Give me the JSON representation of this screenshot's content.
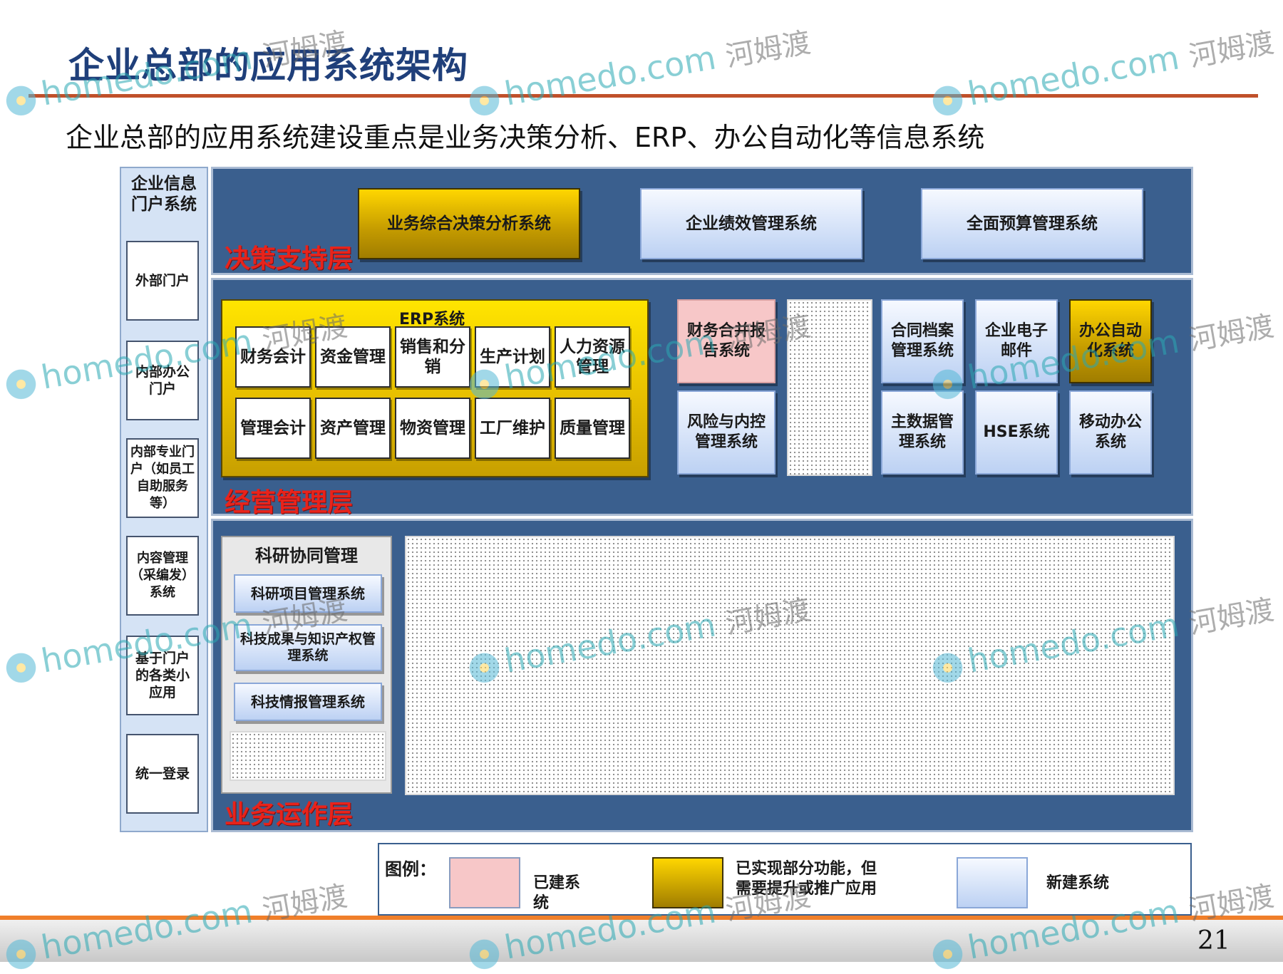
{
  "title": "企业总部的应用系统架构",
  "subtitle": "企业总部的应用系统建设重点是业务决策分析、ERP、办公自动化等信息系统",
  "portal": {
    "header": "企业信息门户系统",
    "items": [
      "外部门户",
      "内部办公门户",
      "内部专业门户（如员工自助服务等）",
      "内容管理（采编发）系统",
      "基于门户的各类小应用",
      "统一登录"
    ]
  },
  "decision_layer": {
    "label": "决策支持层",
    "systems": [
      "业务综合决策分析系统",
      "企业绩效管理系统",
      "全面预算管理系统"
    ]
  },
  "management_layer": {
    "label": "经营管理层",
    "erp": {
      "title": "ERP系统",
      "row1": [
        "财务会计",
        "资金管理",
        "销售和分销",
        "生产计划",
        "人力资源管理"
      ],
      "row2": [
        "管理会计",
        "资产管理",
        "物资管理",
        "工厂维护",
        "质量管理"
      ]
    },
    "systems": {
      "consolidation": "财务合并报告系统",
      "risk": "风险与内控管理系统",
      "contract": "合同档案管理系统",
      "email": "企业电子邮件",
      "oa": "办公自动化系统",
      "master_data": "主数据管理系统",
      "hse": "HSE系统",
      "mobile": "移动办公系统"
    }
  },
  "operation_layer": {
    "label": "业务运作层",
    "research": {
      "title": "科研协同管理",
      "items": [
        "科研项目管理系统",
        "科技成果与知识产权管理系统",
        "科技情报管理系统"
      ]
    }
  },
  "legend": {
    "title": "图例：",
    "items": [
      {
        "label": "已建系统",
        "color": "#f7c7c8"
      },
      {
        "label": "已实现部分功能，但需要提升或推广应用",
        "color": "#e0b400"
      },
      {
        "label": "新建系统",
        "color": "#cfdcf5"
      }
    ]
  },
  "page_number": "21",
  "watermark": {
    "text": "homedo.com",
    "cn": "河姆渡"
  }
}
